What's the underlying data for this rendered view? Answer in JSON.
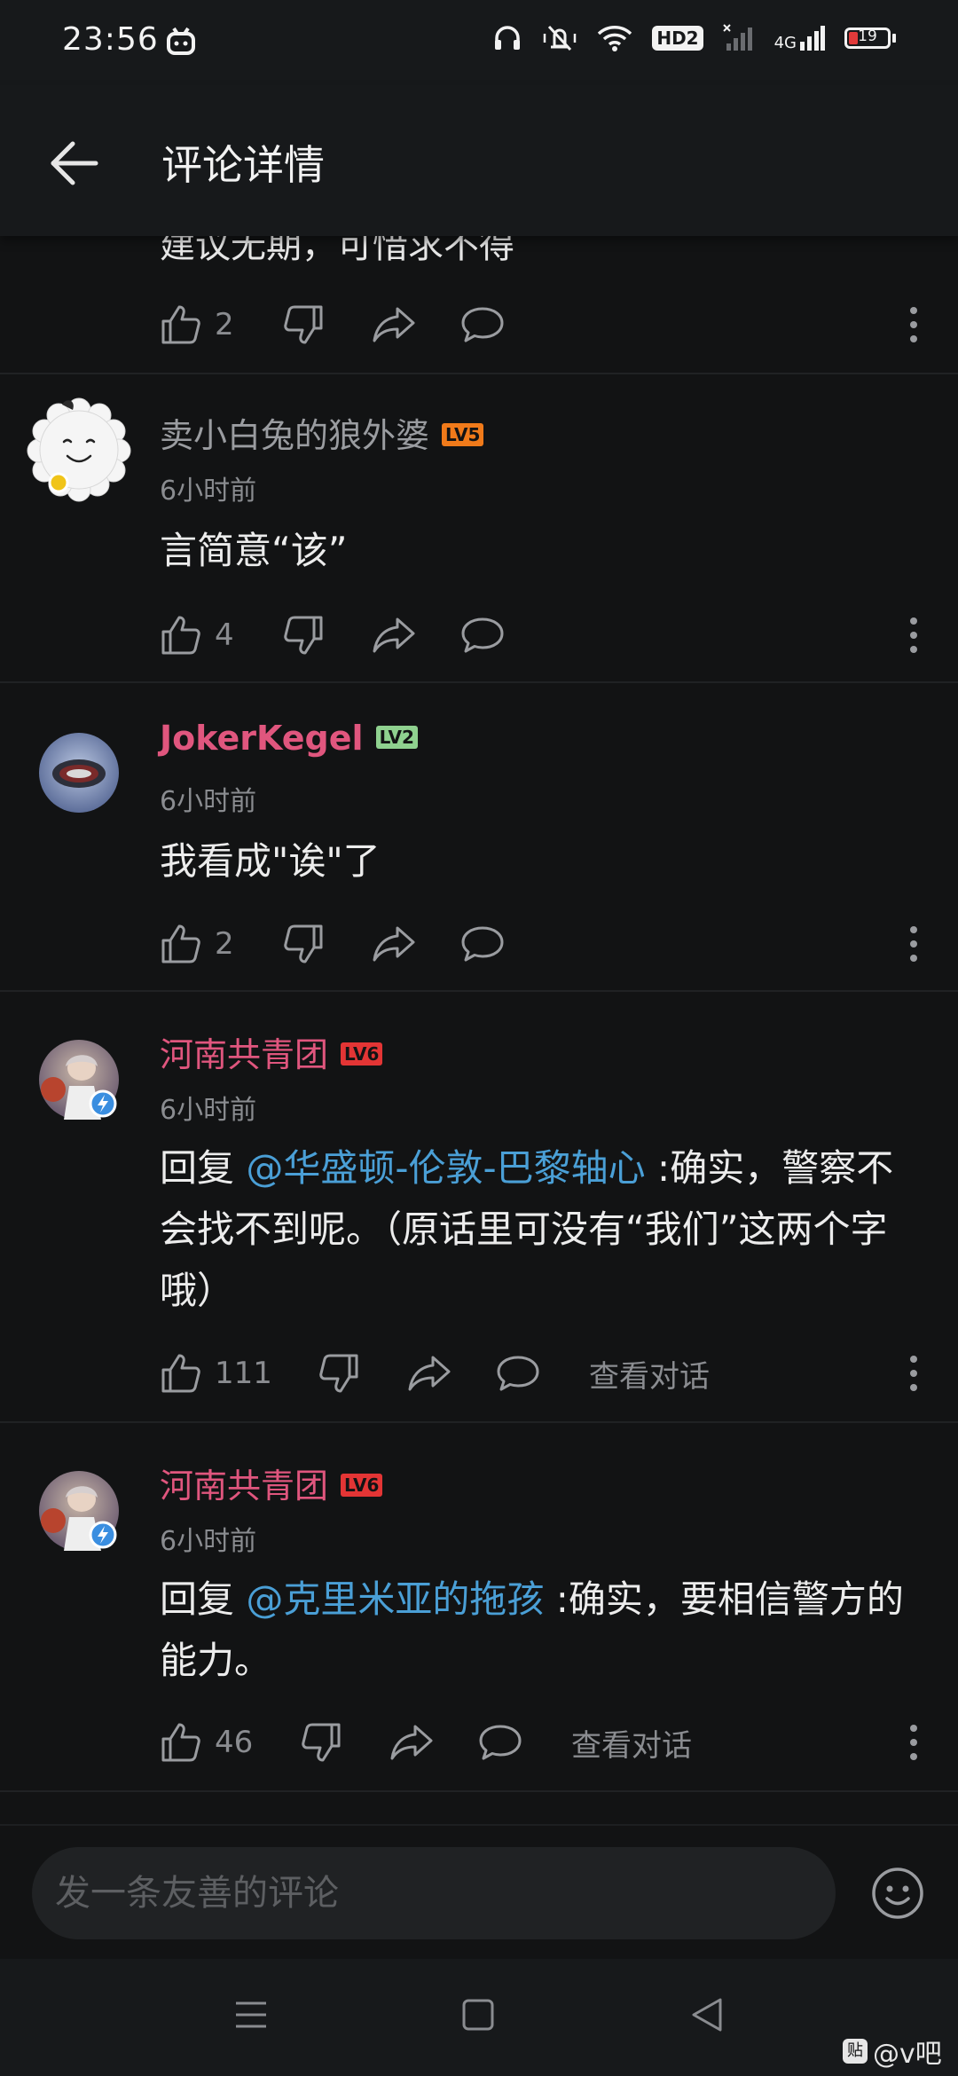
{
  "status_bar": {
    "time": "23:56",
    "network_label": "4G",
    "hd_label": "HD2",
    "battery_level": "19"
  },
  "header": {
    "title": "评论详情",
    "back_icon": "arrow-left-icon"
  },
  "partial_comment": {
    "text": "建议无期，可惜求不得",
    "like_count": "2"
  },
  "comments": [
    {
      "username": "卖小白兔的狼外婆",
      "username_color": "#9a9ca0",
      "level": "LV5",
      "level_color": "#f07a1a",
      "time": "6小时前",
      "text": "言简意“该”",
      "like_count": "4"
    },
    {
      "username": "JokerKegel",
      "username_color": "#e0567e",
      "level": "LV2",
      "level_color": "#8fd18f",
      "time": "6小时前",
      "text": "我看成\"诶\"了",
      "like_count": "2"
    },
    {
      "username": "河南共青团",
      "username_color": "#e0567e",
      "level": "LV6",
      "level_color": "#e33535",
      "time": "6小时前",
      "reply_prefix": "回复",
      "mention": "@华盛顿-伦敦-巴黎轴心",
      "text": ":确实，警察不会找不到呢。（原话里可没有“我们”这两个字哦）",
      "like_count": "111",
      "view_conversation": "查看对话"
    },
    {
      "username": "河南共青团",
      "username_color": "#e0567e",
      "level": "LV6",
      "level_color": "#e33535",
      "time": "6小时前",
      "reply_prefix": "回复",
      "mention": "@克里米亚的拖孩",
      "text": ":确实，要相信警方的能力。",
      "like_count": "46",
      "view_conversation": "查看对话"
    }
  ],
  "input": {
    "placeholder": "发一条友善的评论"
  },
  "watermark": {
    "badge": "贴",
    "text": "@v吧"
  }
}
